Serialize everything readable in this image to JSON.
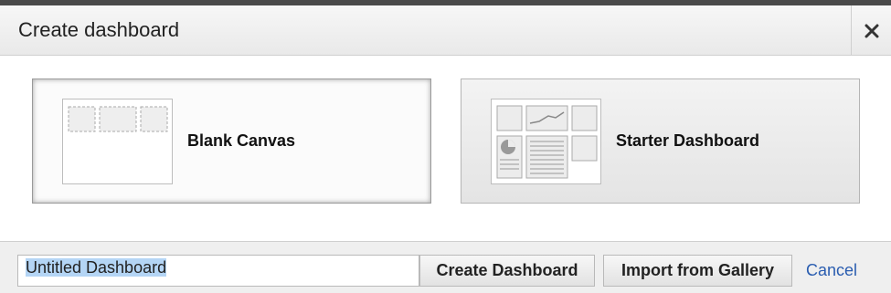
{
  "dialog": {
    "title": "Create dashboard",
    "close_icon": "close-icon"
  },
  "templates": [
    {
      "label": "Blank Canvas",
      "selected": true,
      "icon": "blank-canvas-thumbnail"
    },
    {
      "label": "Starter Dashboard",
      "selected": false,
      "icon": "starter-dashboard-thumbnail"
    }
  ],
  "footer": {
    "name_value": "Untitled Dashboard",
    "create_label": "Create Dashboard",
    "import_label": "Import from Gallery",
    "cancel_label": "Cancel"
  },
  "colors": {
    "link": "#2a5db0",
    "selection": "#b4d5f5"
  }
}
